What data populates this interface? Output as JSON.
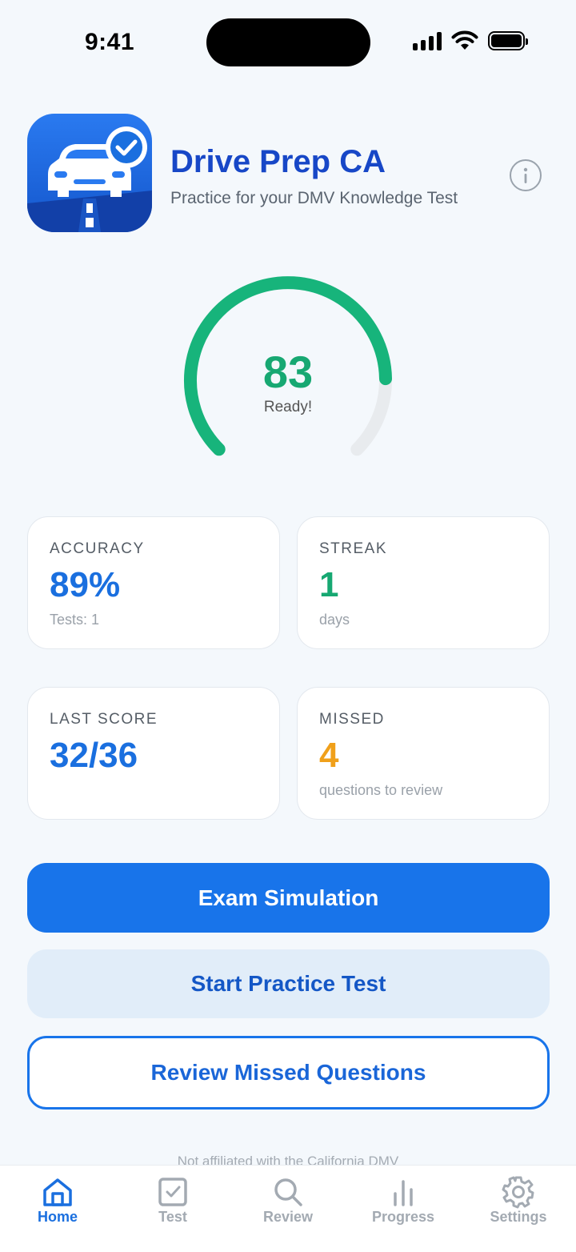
{
  "status_bar": {
    "time": "9:41"
  },
  "header": {
    "title": "Drive Prep CA",
    "subtitle": "Practice for your DMV Knowledge Test"
  },
  "readiness": {
    "score": "83",
    "label": "Ready!",
    "fraction": 0.83
  },
  "stats": {
    "accuracy": {
      "label": "ACCURACY",
      "value": "89%",
      "sub": "Tests: 1"
    },
    "streak": {
      "label": "STREAK",
      "value": "1",
      "sub": "days"
    },
    "last_score": {
      "label": "LAST SCORE",
      "value": "32/36",
      "sub": ""
    },
    "missed": {
      "label": "MISSED",
      "value": "4",
      "sub": "questions to review"
    }
  },
  "actions": {
    "exam_simulation": "Exam Simulation",
    "start_practice": "Start Practice Test",
    "review_missed": "Review Missed Questions"
  },
  "disclaimer": "Not affiliated with the California DMV",
  "tabs": [
    {
      "label": "Home",
      "icon": "home-icon",
      "active": true
    },
    {
      "label": "Test",
      "icon": "checkbox-icon",
      "active": false
    },
    {
      "label": "Review",
      "icon": "search-icon",
      "active": false
    },
    {
      "label": "Progress",
      "icon": "bar-chart-icon",
      "active": false
    },
    {
      "label": "Settings",
      "icon": "gear-icon",
      "active": false
    }
  ],
  "colors": {
    "primary": "#1874ea",
    "title": "#1747c7",
    "green": "#17a872",
    "orange": "#f0a01a"
  }
}
